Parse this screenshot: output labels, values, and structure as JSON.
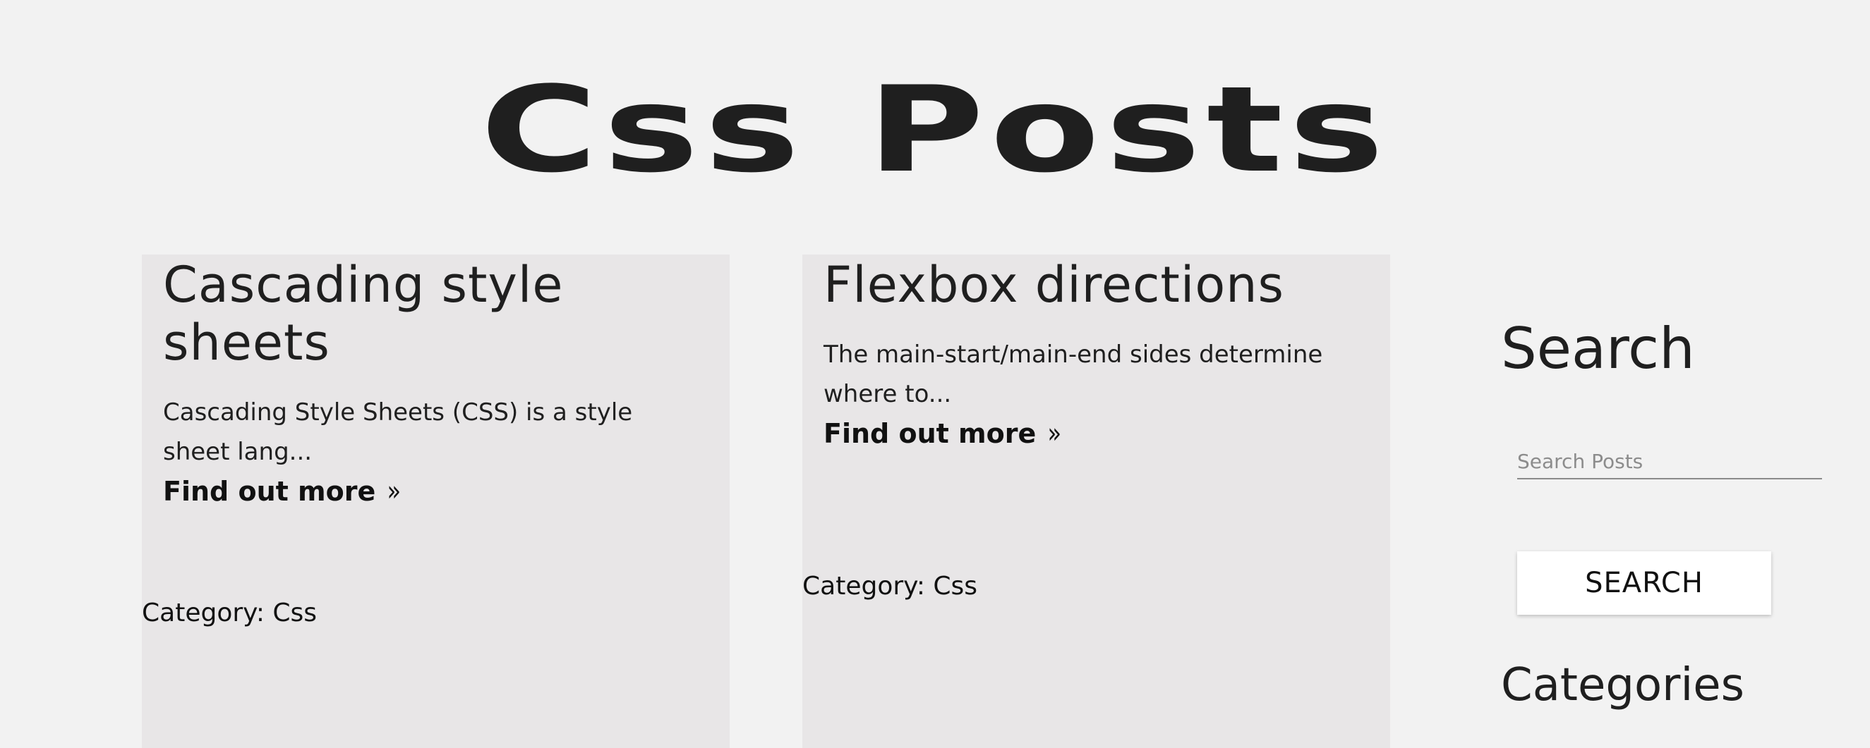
{
  "page": {
    "title": "Css Posts"
  },
  "posts": [
    {
      "title": "Cascading style sheets",
      "excerpt": "Cascading Style Sheets (CSS) is a style sheet lang...",
      "link_label": "Find out more",
      "link_icon": "double-chevron-right-icon",
      "category": "Category: Css"
    },
    {
      "title": "Flexbox directions",
      "excerpt": "The main-start/main-end sides determine where to...",
      "link_label": "Find out more",
      "link_icon": "double-chevron-right-icon",
      "category": "Category: Css"
    }
  ],
  "sidebar": {
    "search_heading": "Search",
    "search_placeholder": "Search Posts",
    "search_button_label": "SEARCH",
    "categories_heading": "Categories"
  },
  "colors": {
    "background": "#f2f2f2",
    "card_background": "#e8e6e7",
    "text": "#1f1f1f",
    "button_background": "#ffffff"
  }
}
